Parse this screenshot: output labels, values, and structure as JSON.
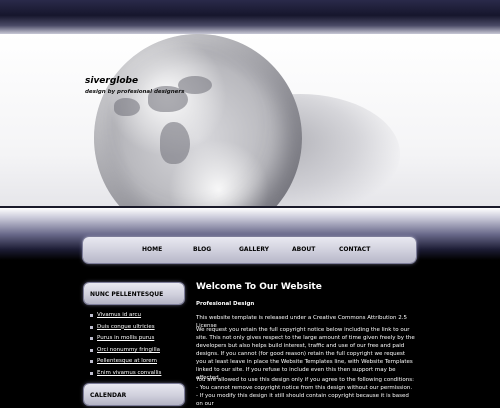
{
  "header": {
    "site_title": "siverglobe",
    "slogan": "design by profesional designers"
  },
  "nav": {
    "items": [
      "HOME",
      "BLOG",
      "GALLERY",
      "ABOUT",
      "CONTACT"
    ]
  },
  "sidebar": {
    "heading_1": "NUNC PELLENTESQUE",
    "links": [
      "Vivamus id arcu",
      "Duis congue ultricies",
      "Purus in mollis purus",
      "Orci nonummy fringilla",
      "Pellentesque at lorem",
      "Enim vivamus convallis"
    ],
    "heading_2": "CALENDAR"
  },
  "main": {
    "title": "Welcome To Our Website",
    "subtitle": "Profesional Design",
    "para1": "This website template is released under a Creative Commons Attribution 2.5 License",
    "para2": "We request you retain the full copyright notice below including the link to our site. This not only gives respect to the large amount of time given freely by the developers but also helps build interest, traffic and use of our free and paid designs. If you cannot (for good reason) retain the full copyright we request you at least leave in place the Website Templates line, with Website Templates linked to our site. If you refuse to include even this then support may be affected.",
    "para3": "You are allowed to use this design only if you agree to the following conditions:\n- You cannot remove copyright notice from this design without our permission.\n- If you modify this design it still should contain copyright because it is based on our"
  },
  "colors": {
    "page_background": "#000000",
    "nav_background": "#cfcfdc",
    "text_light": "#ffffff",
    "text_dark": "#000000"
  }
}
